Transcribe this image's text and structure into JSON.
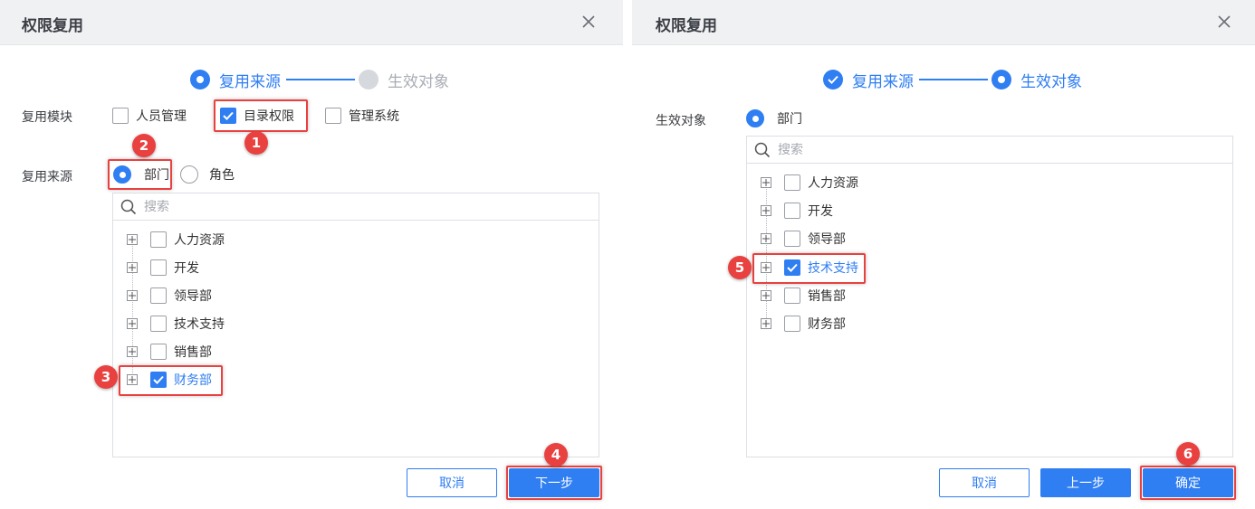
{
  "left": {
    "title": "权限复用",
    "steps": [
      "复用来源",
      "生效对象"
    ],
    "module_label": "复用模块",
    "modules": [
      {
        "label": "人员管理",
        "checked": false
      },
      {
        "label": "目录权限",
        "checked": true
      },
      {
        "label": "管理系统",
        "checked": false
      }
    ],
    "source_label": "复用来源",
    "source_options": [
      {
        "label": "部门",
        "selected": true
      },
      {
        "label": "角色",
        "selected": false
      }
    ],
    "search_placeholder": "搜索",
    "tree": [
      {
        "label": "人力资源",
        "checked": false
      },
      {
        "label": "开发",
        "checked": false
      },
      {
        "label": "领导部",
        "checked": false
      },
      {
        "label": "技术支持",
        "checked": false
      },
      {
        "label": "销售部",
        "checked": false
      },
      {
        "label": "财务部",
        "checked": true
      }
    ],
    "cancel": "取消",
    "next": "下一步"
  },
  "right": {
    "title": "权限复用",
    "steps": [
      "复用来源",
      "生效对象"
    ],
    "target_label": "生效对象",
    "target_option": "部门",
    "search_placeholder": "搜索",
    "tree": [
      {
        "label": "人力资源",
        "checked": false
      },
      {
        "label": "开发",
        "checked": false
      },
      {
        "label": "领导部",
        "checked": false
      },
      {
        "label": "技术支持",
        "checked": true
      },
      {
        "label": "销售部",
        "checked": false
      },
      {
        "label": "财务部",
        "checked": false
      }
    ],
    "cancel": "取消",
    "prev": "上一步",
    "confirm": "确定"
  },
  "annotations": [
    "1",
    "2",
    "3",
    "4",
    "5",
    "6"
  ],
  "colors": {
    "accent": "#2f7ef2",
    "highlight": "#e8413f",
    "titlebar": "#f0f1f3"
  },
  "icons": {
    "close": "close-icon",
    "search": "search-icon",
    "check": "check-icon",
    "expand": "plus-square-icon"
  }
}
